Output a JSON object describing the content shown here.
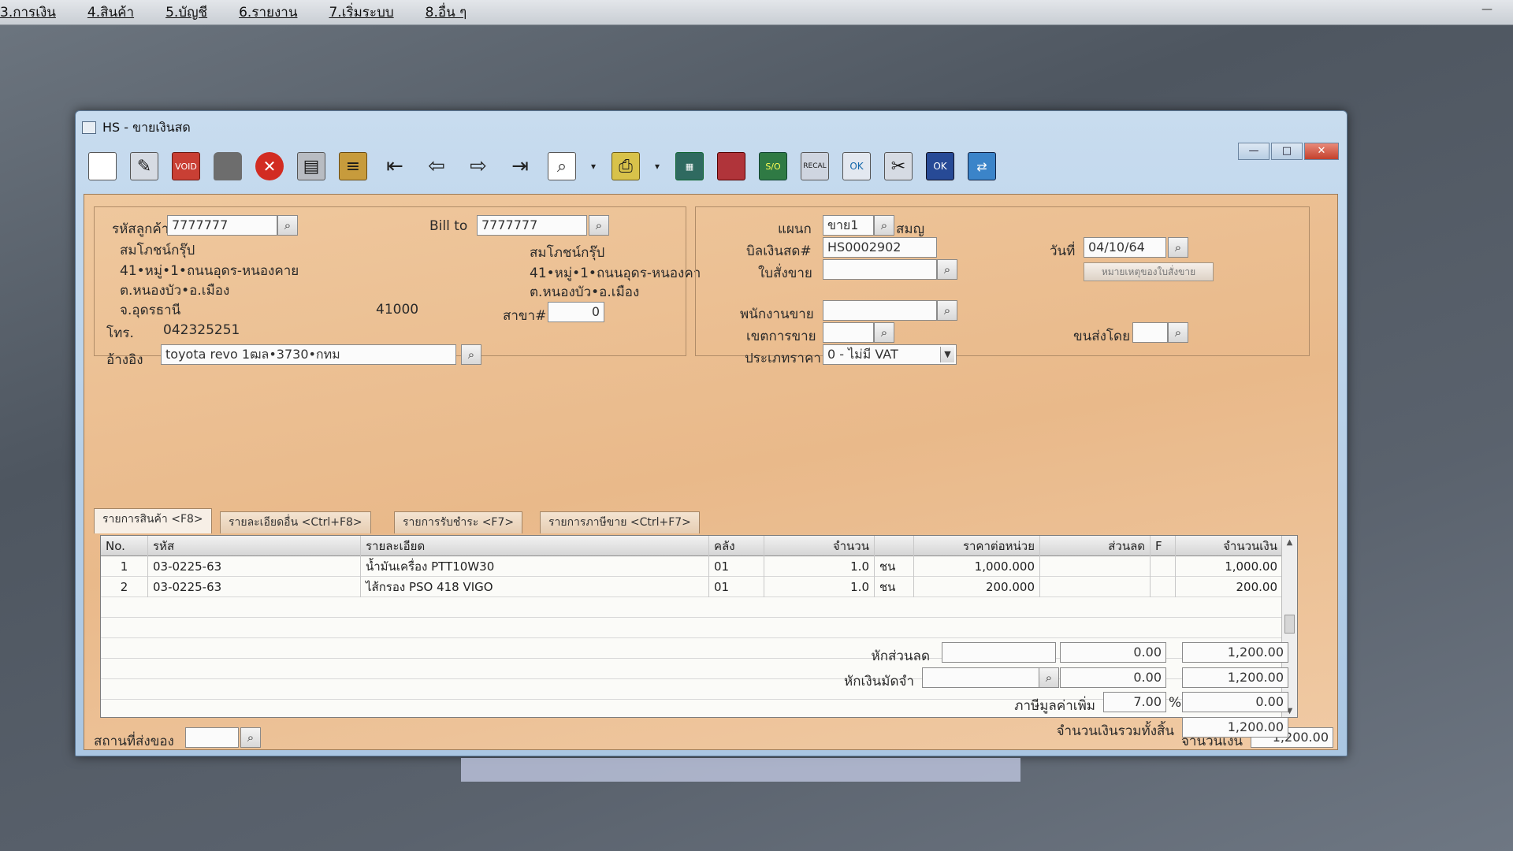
{
  "menu": {
    "items": [
      "3.การเงิน",
      "4.สินค้า",
      "5.บัญชี",
      "6.รายงาน",
      "7.เริ่มระบบ",
      "8.อื่น ๆ"
    ]
  },
  "window": {
    "title": "HS - ขายเงินสด",
    "minimize": "—",
    "maximize": "□",
    "close": "✕"
  },
  "toolbar": {
    "icons": [
      "new-icon",
      "edit-icon",
      "void-icon",
      "delete-icon",
      "cancel-icon",
      "save-icon",
      "books-icon",
      "first-icon",
      "prev-icon",
      "next-icon",
      "last-icon",
      "find-icon",
      "print-icon",
      "grid-icon",
      "red-doc-icon",
      "so-icon",
      "recalc-icon",
      "ok-person-icon",
      "approve-icon",
      "ok-blue-icon",
      "network-icon"
    ],
    "void_text": "VOID",
    "so_text": "S/O",
    "recal_text": "RECAL",
    "ok_text": "OK"
  },
  "customer": {
    "code_label": "รหัสลูกค้า",
    "code_value": "7777777",
    "name": "สมโภชน์กรุ๊ป",
    "addr1": "41•หมู่•1•ถนนอุดร-หนองคาย",
    "addr2": "ต.หนองบัว•อ.เมือง",
    "addr3": "จ.อุดรธานี",
    "zip": "41000",
    "tel_label": "โทร.",
    "tel_value": "042325251",
    "ref_label": "อ้างอิง",
    "ref_value": "toyota revo 1ฒล•3730•กทม"
  },
  "billto": {
    "label": "Bill to",
    "value": "7777777",
    "name": "สมโภชน์กรุ๊ป",
    "addr1": "41•หมู่•1•ถนนอุดร-หนองคา",
    "addr2": "ต.หนองบัว•อ.เมือง",
    "branch_label": "สาขา#",
    "branch_value": "0"
  },
  "doc": {
    "dept_label": "แผนก",
    "dept_value": "ขาย1",
    "dept_name": "สมญ",
    "bill_label": "บิลเงินสด#",
    "bill_value": "HS0002902",
    "date_label": "วันที่",
    "date_value": "04/10/64",
    "order_label": "ใบสั่งขาย",
    "order_value": "",
    "order_note_button": "หมายเหตุของใบสั่งขาย",
    "salesman_label": "พนักงานขาย",
    "salesman_value": "",
    "area_label": "เขตการขาย",
    "area_value": "",
    "ship_by_label": "ขนส่งโดย",
    "ship_by_value": "",
    "price_type_label": "ประเภทราคา",
    "price_type_value": "0 - ไม่มี VAT"
  },
  "tabs": [
    {
      "label": "รายการสินค้า <F8>"
    },
    {
      "label": "รายละเอียดอื่น <Ctrl+F8>"
    },
    {
      "label": "รายการรับชำระ <F7>"
    },
    {
      "label": "รายการภาษีขาย <Ctrl+F7>"
    }
  ],
  "grid": {
    "headers": [
      "No.",
      "รหัส",
      "รายละเอียด",
      "คลัง",
      "จำนวน",
      "",
      "ราคาต่อหน่วย",
      "ส่วนลด",
      "F",
      "จำนวนเงิน"
    ],
    "rows": [
      {
        "no": "1",
        "code": "03-0225-63",
        "desc": "น้ำมันเครื่อง PTT10W30",
        "wh": "01",
        "qty": "1.0",
        "unit": "ชน",
        "price": "1,000.000",
        "disc": "",
        "f": "",
        "amount": "1,000.00"
      },
      {
        "no": "2",
        "code": "03-0225-63",
        "desc": "ไส้กรอง PSO 418 VIGO",
        "wh": "01",
        "qty": "1.0",
        "unit": "ชน",
        "price": "200.000",
        "disc": "",
        "f": "",
        "amount": "200.00"
      }
    ]
  },
  "footer": {
    "ship_place_label": "สถานที่ส่งของ",
    "ship_place_value": "",
    "amount_label": "จำนวนเงิน",
    "amount_value": "1,200.00",
    "discount_label": "หักส่วนลด",
    "discount_text": "",
    "discount_value": "0.00",
    "discount_total": "1,200.00",
    "deposit_label": "หักเงินมัดจำ",
    "deposit_text": "",
    "deposit_value": "0.00",
    "deposit_total": "1,200.00",
    "vat_label": "ภาษีมูลค่าเพิ่ม",
    "vat_rate": "7.00",
    "vat_pct": "%",
    "vat_value": "0.00",
    "grand_label": "จำนวนเงินรวมทั้งสิ้น",
    "grand_value": "1,200.00"
  }
}
